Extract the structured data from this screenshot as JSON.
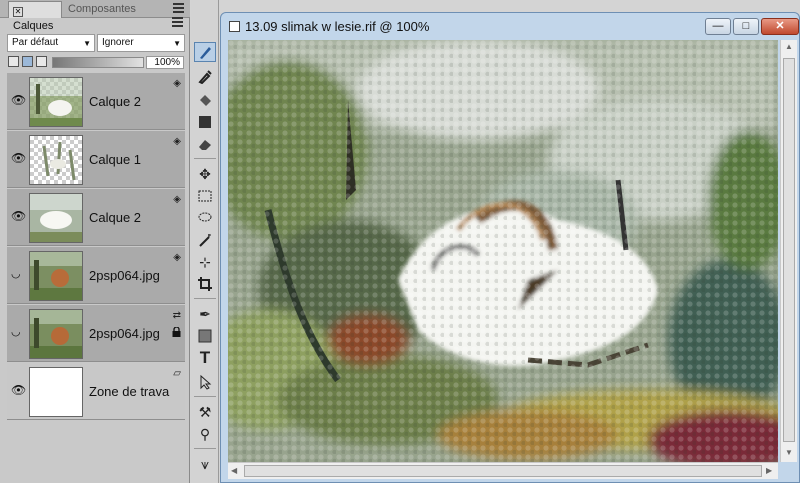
{
  "panel": {
    "tabs": [
      {
        "label": "Calques",
        "active": true
      },
      {
        "label": "Composantes",
        "active": false
      }
    ],
    "blend_mode": "Par défaut",
    "composite": "Ignorer",
    "opacity": "100%"
  },
  "layers": [
    {
      "name": "Calque 2",
      "visible": true,
      "locked": false
    },
    {
      "name": "Calque 1",
      "visible": true,
      "locked": false
    },
    {
      "name": "Calque 2",
      "visible": true,
      "locked": false
    },
    {
      "name": "2psp064.jpg",
      "visible": false,
      "locked": false
    },
    {
      "name": "2psp064.jpg",
      "visible": false,
      "locked": true
    },
    {
      "name": "Zone de trava",
      "visible": true,
      "locked": false
    }
  ],
  "toolbox": {
    "tools": [
      "brush-icon",
      "dropper-icon",
      "paint-bucket-icon",
      "gradient-icon",
      "eraser-icon",
      "layer-adjuster-icon",
      "rect-select-icon",
      "lasso-icon",
      "magic-wand-icon",
      "transform-icon",
      "crop-icon",
      "pen-icon",
      "shape-icon",
      "text-icon",
      "selection-arrow-icon",
      "cloner-icon",
      "rubber-stamp-icon",
      "divine-proportion-icon"
    ]
  },
  "document": {
    "title": "13.09 slimak w lesie.rif @ 100%",
    "minimize": "—",
    "maximize": "□",
    "close": "✕"
  },
  "colors": {
    "panel_bg": "#c9c9c9",
    "layer_row": "#aaaaaa",
    "window_frame": "#c2d6ea",
    "close_button": "#c0492e"
  }
}
